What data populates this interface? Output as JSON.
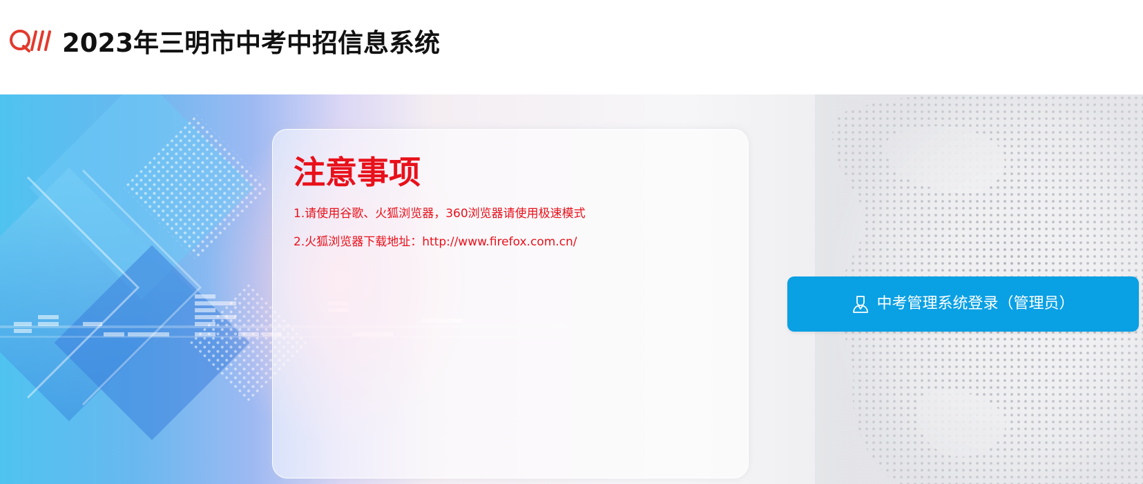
{
  "header": {
    "logo_icon": "qm-logo",
    "title": "2023年三明市中考中招信息系统"
  },
  "notice": {
    "title": "注意事项",
    "items": [
      "1.请使用谷歌、火狐浏览器，360浏览器请使用极速模式",
      "2.火狐浏览器下载地址：http://www.firefox.com.cn/"
    ]
  },
  "login": {
    "icon": "user-icon",
    "label": "中考管理系统登录（管理员）"
  },
  "colors": {
    "accent_red": "#e8101a",
    "button_blue": "#0aa0e4",
    "logo_red": "#e23a2e"
  }
}
